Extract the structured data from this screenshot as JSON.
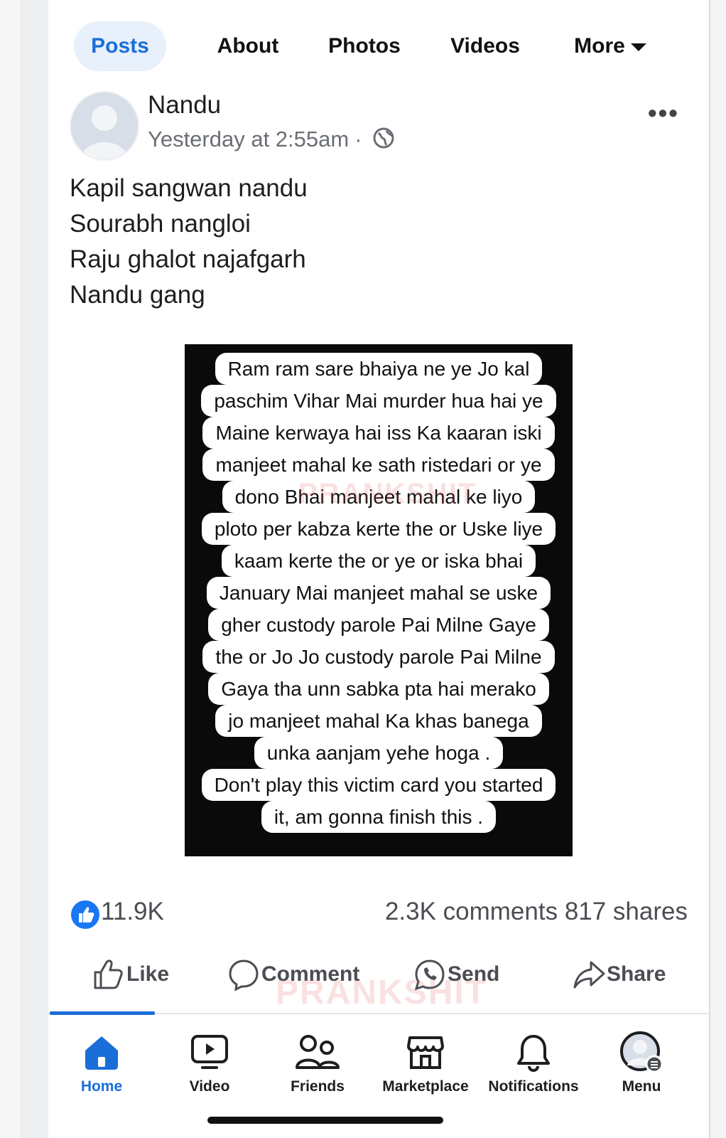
{
  "tabs": [
    {
      "label": "Posts"
    },
    {
      "label": "About"
    },
    {
      "label": "Photos"
    },
    {
      "label": "Videos"
    },
    {
      "label": "More"
    }
  ],
  "post": {
    "author": "Nandu",
    "time": "Yesterday at 2:55am",
    "separator": "·",
    "menu_icon": "more-options-icon",
    "text_lines": [
      "Kapil sangwan nandu",
      "Sourabh nangloi",
      "Raju ghalot najafgarh",
      "Nandu gang"
    ],
    "image_lines": [
      "Ram ram sare bhaiya ne ye Jo kal",
      "paschim Vihar Mai  murder hua hai ye",
      "Maine kerwaya hai iss Ka kaaran iski",
      "manjeet mahal ke sath ristedari or ye",
      "dono Bhai manjeet mahal ke liyo",
      "ploto per kabza kerte the or Uske liye",
      "kaam kerte the or ye or iska bhai",
      "January Mai manjeet mahal se uske",
      "gher  custody parole Pai Milne Gaye",
      "the or Jo Jo custody parole Pai Milne",
      "Gaya tha unn sabka pta hai merako",
      "jo manjeet mahal Ka khas banega",
      "unka aanjam  yehe hoga .",
      "Don't play this victim card you started",
      "it, am gonna finish this ."
    ],
    "watermark": "PRANKSHIT"
  },
  "reactions": {
    "likes": "11.9K",
    "comments_shares": "2.3K comments 817 shares"
  },
  "actions": {
    "like": "Like",
    "comment": "Comment",
    "send": "Send",
    "share": "Share"
  },
  "bottom_nav": [
    {
      "label": "Home",
      "icon": "home-icon"
    },
    {
      "label": "Video",
      "icon": "video-icon"
    },
    {
      "label": "Friends",
      "icon": "friends-icon"
    },
    {
      "label": "Marketplace",
      "icon": "marketplace-icon"
    },
    {
      "label": "Notifications",
      "icon": "bell-icon"
    },
    {
      "label": "Menu",
      "icon": "profile-menu-icon"
    }
  ],
  "colors": {
    "accent": "#1a6ed8",
    "like_blue": "#1877f2",
    "text": "#1c1e21",
    "muted": "#6a6e74"
  }
}
